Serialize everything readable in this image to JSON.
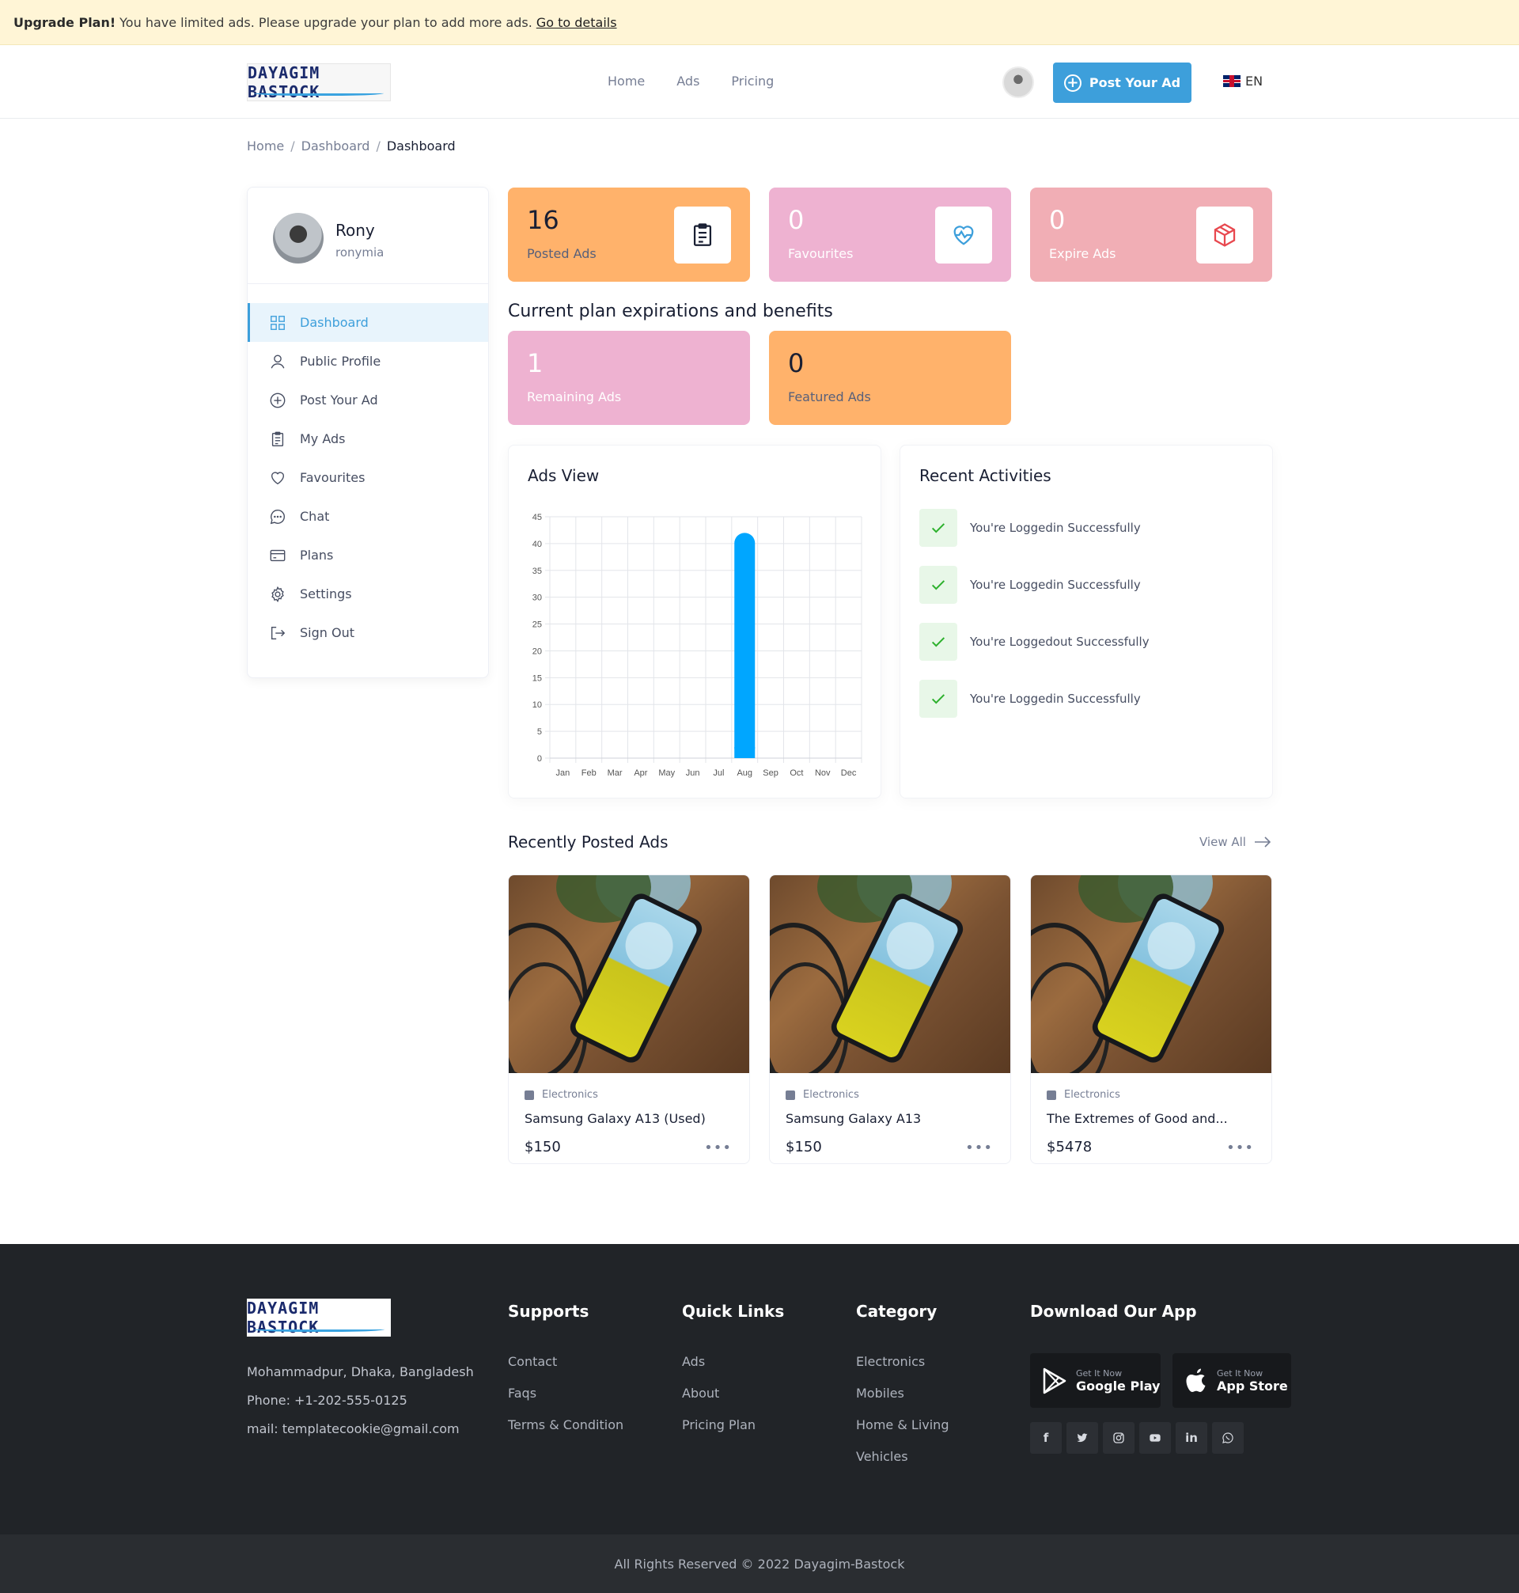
{
  "banner": {
    "title": "Upgrade Plan!",
    "message": "You have limited ads. Please upgrade your plan to add more ads.",
    "link": "Go to details"
  },
  "header": {
    "logo": "DAYAGIM BASTOCK",
    "nav": [
      "Home",
      "Ads",
      "Pricing"
    ],
    "post_button": "Post Your Ad",
    "language": "EN"
  },
  "breadcrumb": [
    "Home",
    "Dashboard",
    "Dashboard"
  ],
  "sidebar": {
    "name": "Rony",
    "username": "ronymia",
    "items": [
      {
        "label": "Dashboard",
        "icon": "grid-icon"
      },
      {
        "label": "Public Profile",
        "icon": "user-icon"
      },
      {
        "label": "Post Your Ad",
        "icon": "plus-circle-icon"
      },
      {
        "label": "My Ads",
        "icon": "clipboard-icon"
      },
      {
        "label": "Favourites",
        "icon": "heart-icon"
      },
      {
        "label": "Chat",
        "icon": "chat-icon"
      },
      {
        "label": "Plans",
        "icon": "card-icon"
      },
      {
        "label": "Settings",
        "icon": "gear-icon"
      },
      {
        "label": "Sign Out",
        "icon": "sign-out-icon"
      }
    ]
  },
  "stats": [
    {
      "value": "16",
      "label": "Posted Ads",
      "color": "#ffb26b"
    },
    {
      "value": "0",
      "label": "Favourites",
      "color": "#eeb2d1"
    },
    {
      "value": "0",
      "label": "Expire Ads",
      "color": "#f1aeb5"
    }
  ],
  "plan": {
    "title": "Current plan expirations and benefits",
    "cards": [
      {
        "value": "1",
        "label": "Remaining Ads",
        "color": "#eeb2d1"
      },
      {
        "value": "0",
        "label": "Featured Ads",
        "color": "#ffb26b"
      }
    ]
  },
  "ads_view": {
    "title": "Ads View"
  },
  "chart_data": {
    "type": "bar",
    "categories": [
      "Jan",
      "Feb",
      "Mar",
      "Apr",
      "May",
      "Jun",
      "Jul",
      "Aug",
      "Sep",
      "Oct",
      "Nov",
      "Dec"
    ],
    "values": [
      0,
      0,
      0,
      0,
      0,
      0,
      0,
      42,
      0,
      0,
      0,
      0
    ],
    "yticks": [
      "0",
      "5",
      "10",
      "15",
      "20",
      "25",
      "30",
      "35",
      "40",
      "45"
    ],
    "ylim": [
      0,
      45
    ],
    "grid": true,
    "bar_color": "#00a6ff"
  },
  "activities": {
    "title": "Recent Activities",
    "items": [
      "You're Loggedin Successfully",
      "You're Loggedin Successfully",
      "You're Loggedout Successfully",
      "You're Loggedin Successfully"
    ]
  },
  "recent_ads": {
    "title": "Recently Posted Ads",
    "view_all": "View All",
    "items": [
      {
        "category": "Electronics",
        "title": "Samsung Galaxy A13 (Used)",
        "price": "$150"
      },
      {
        "category": "Electronics",
        "title": "Samsung Galaxy A13",
        "price": "$150"
      },
      {
        "category": "Electronics",
        "title": "The Extremes of Good and...",
        "price": "$5478"
      }
    ]
  },
  "footer": {
    "address": "Mohammadpur, Dhaka, Bangladesh",
    "phone": "Phone: +1-202-555-0125",
    "mail": "mail: templatecookie@gmail.com",
    "supports": {
      "title": "Supports",
      "links": [
        "Contact",
        "Faqs",
        "Terms & Condition"
      ]
    },
    "quick_links": {
      "title": "Quick Links",
      "links": [
        "Ads",
        "About",
        "Pricing Plan"
      ]
    },
    "category": {
      "title": "Category",
      "links": [
        "Electronics",
        "Mobiles",
        "Home & Living",
        "Vehicles"
      ]
    },
    "app": {
      "title": "Download Our App",
      "google": {
        "small": "Get It Now",
        "big": "Google Play"
      },
      "apple": {
        "small": "Get It Now",
        "big": "App Store"
      }
    },
    "social": [
      "facebook-icon",
      "twitter-icon",
      "instagram-icon",
      "youtube-icon",
      "linkedin-icon",
      "whatsapp-icon"
    ],
    "copyright": "All Rights Reserved © 2022 Dayagim-Bastock"
  }
}
